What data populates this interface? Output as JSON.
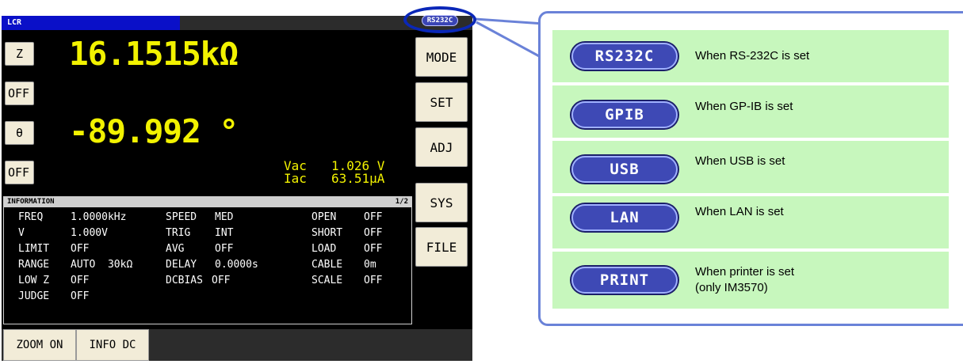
{
  "screen": {
    "title": "LCR",
    "params": [
      {
        "button": "Z",
        "value": "16.1515kΩ"
      },
      {
        "button": "OFF"
      },
      {
        "button": "θ",
        "value": "-89.992 °"
      },
      {
        "button": "OFF"
      }
    ],
    "monitor": {
      "vac_label": "Vac",
      "vac_value": "1.026 V",
      "iac_label": "Iac",
      "iac_value": "63.51μA"
    },
    "menu": [
      "MODE",
      "SET",
      "ADJ",
      "SYS",
      "FILE"
    ],
    "interface_indicator": "RS232C",
    "info": {
      "title": "INFORMATION",
      "page": "1/2",
      "col1": [
        {
          "label": "FREQ",
          "value": "1.0000kHz"
        },
        {
          "label": "V",
          "value": "1.000V"
        },
        {
          "label": "LIMIT",
          "value": "OFF"
        },
        {
          "label": "RANGE",
          "value": "AUTO  30kΩ"
        },
        {
          "label": "LOW Z",
          "value": "OFF"
        },
        {
          "label": "JUDGE",
          "value": "OFF"
        }
      ],
      "col2": [
        {
          "label": "SPEED",
          "value": "MED"
        },
        {
          "label": "TRIG",
          "value": "INT"
        },
        {
          "label": "AVG",
          "value": "OFF"
        },
        {
          "label": "DELAY",
          "value": "0.0000s"
        },
        {
          "label": "DCBIAS",
          "value": "OFF"
        }
      ],
      "col3": [
        {
          "label": "OPEN",
          "value": "OFF"
        },
        {
          "label": "SHORT",
          "value": "OFF"
        },
        {
          "label": "LOAD",
          "value": "OFF"
        },
        {
          "label": "CABLE",
          "value": "0m"
        },
        {
          "label": "SCALE",
          "value": "OFF"
        }
      ]
    },
    "bottom_buttons": [
      "ZOOM ON",
      "INFO DC"
    ]
  },
  "legend": [
    {
      "badge": "RS232C",
      "text": "When RS-232C is set"
    },
    {
      "badge": "GPIB",
      "text": "When GP-IB is set"
    },
    {
      "badge": "USB",
      "text": "When USB is set"
    },
    {
      "badge": "LAN",
      "text": "When LAN is set"
    },
    {
      "badge": "PRINT",
      "text": "When printer is set\n(only IM3570)"
    }
  ],
  "colors": {
    "value_yellow": "#f2f200",
    "title_blue": "#0a10c8",
    "badge_blue": "#3e49b5",
    "row_green": "#c7f7bd",
    "callout_border": "#6a82d8"
  }
}
